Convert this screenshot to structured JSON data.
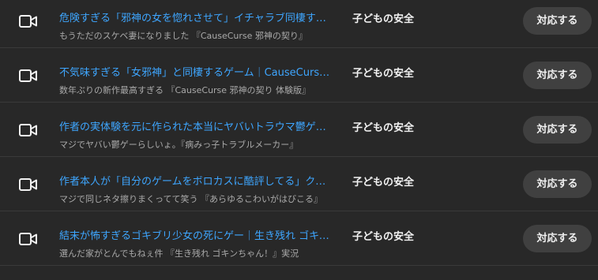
{
  "rows": [
    {
      "icon": "video-camera-icon",
      "title": "危険すぎる「邪神の女を惚れさせて」イチャラブ同棲するゲーム｜CauseCurse 邪神の契り",
      "description": "もうただのスケベ妻になりました 『CauseCurse 邪神の契り』",
      "category": "子どもの安全",
      "action_label": "対応する"
    },
    {
      "icon": "video-camera-icon",
      "title": "不気味すぎる「女邪神」と同棲するゲーム｜CauseCurse 邪神の契り",
      "description": "数年ぶりの新作最高すぎる 『CauseCurse 邪神の契り 体験版』",
      "category": "子どもの安全",
      "action_label": "対応する"
    },
    {
      "icon": "video-camera-icon",
      "title": "作者の実体験を元に作られた本当にヤバいトラウマ鬱ゲーム",
      "description": "マジでヤバい鬱ゲーらしいょ。『病みっ子トラブルメーカー』",
      "category": "子どもの安全",
      "action_label": "対応する"
    },
    {
      "icon": "video-camera-icon",
      "title": "作者本人が「自分のゲームをボロカスに酷評してる」クソゲー",
      "description": "マジで同じネタ擦りまくってて笑う 『あらゆるこわいがはびこる』",
      "category": "子どもの安全",
      "action_label": "対応する"
    },
    {
      "icon": "video-camera-icon",
      "title": "結末が怖すぎるゴキブリ少女の死にゲー｜生き残れ ゴキンちゃん",
      "description": "選んだ家がとんでもねぇ件 『生き残れ ゴキンちゃん！』実況",
      "category": "子どもの安全",
      "action_label": "対応する"
    }
  ],
  "colors": {
    "background": "#282828",
    "title_link": "#3ea6ff",
    "description": "#aaaaaa",
    "category": "#f1f1f1",
    "button_bg": "#404040"
  }
}
